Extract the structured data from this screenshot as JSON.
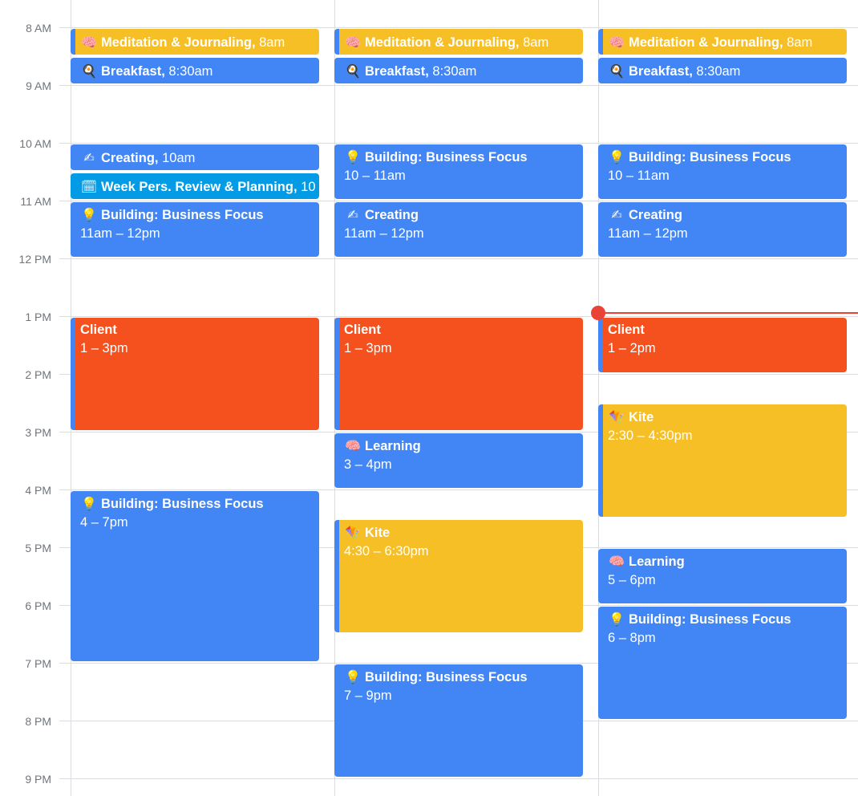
{
  "time_labels": [
    "8 AM",
    "9 AM",
    "10 AM",
    "11 AM",
    "12 PM",
    "1 PM",
    "2 PM",
    "3 PM",
    "4 PM",
    "5 PM",
    "6 PM",
    "7 PM",
    "8 PM",
    "9 PM"
  ],
  "colors": {
    "blue": "#4285f4",
    "yellow": "#f6bf26",
    "orange": "#f4511e",
    "cyan": "#039be5",
    "now_indicator": "#ea4335"
  },
  "days": [
    {
      "events": [
        {
          "title": "Meditation & Journaling,",
          "time": "8am",
          "icon": "brain-icon",
          "glyph": "🧠",
          "color": "yellow"
        },
        {
          "title": "Breakfast,",
          "time": "8:30am",
          "icon": "frying-pan-icon",
          "glyph": "🍳",
          "color": "blue"
        },
        {
          "title": "Creating,",
          "time": "10am",
          "icon": "writing-hand-icon",
          "glyph": "✍",
          "color": "blue"
        },
        {
          "title": "Week Pers. Review & Planning,",
          "time": "10",
          "icon": "calendar-icon",
          "glyph": "🗓",
          "color": "cyan"
        },
        {
          "title": "Building: Business Focus",
          "time": "11am – 12pm",
          "icon": "light-bulb-icon",
          "glyph": "💡",
          "color": "blue"
        },
        {
          "title": "Client",
          "time": "1 – 3pm",
          "icon": "",
          "glyph": "",
          "color": "orange"
        },
        {
          "title": "Building: Business Focus",
          "time": "4 – 7pm",
          "icon": "light-bulb-icon",
          "glyph": "💡",
          "color": "blue"
        }
      ]
    },
    {
      "events": [
        {
          "title": "Meditation & Journaling,",
          "time": "8am",
          "icon": "brain-icon",
          "glyph": "🧠",
          "color": "yellow"
        },
        {
          "title": "Breakfast,",
          "time": "8:30am",
          "icon": "frying-pan-icon",
          "glyph": "🍳",
          "color": "blue"
        },
        {
          "title": "Building: Business Focus",
          "time": "10 – 11am",
          "icon": "light-bulb-icon",
          "glyph": "💡",
          "color": "blue"
        },
        {
          "title": "Creating",
          "time": "11am – 12pm",
          "icon": "writing-hand-icon",
          "glyph": "✍",
          "color": "blue"
        },
        {
          "title": "Client",
          "time": "1 – 3pm",
          "icon": "",
          "glyph": "",
          "color": "orange"
        },
        {
          "title": "Learning",
          "time": "3 – 4pm",
          "icon": "brain-icon",
          "glyph": "🧠",
          "color": "blue"
        },
        {
          "title": "Kite",
          "time": "4:30 – 6:30pm",
          "icon": "kite-icon",
          "glyph": "🪁",
          "color": "yellow"
        },
        {
          "title": "Building: Business Focus",
          "time": "7 – 9pm",
          "icon": "light-bulb-icon",
          "glyph": "💡",
          "color": "blue"
        }
      ]
    },
    {
      "events": [
        {
          "title": "Meditation & Journaling,",
          "time": "8am",
          "icon": "brain-icon",
          "glyph": "🧠",
          "color": "yellow"
        },
        {
          "title": "Breakfast,",
          "time": "8:30am",
          "icon": "frying-pan-icon",
          "glyph": "🍳",
          "color": "blue"
        },
        {
          "title": "Building: Business Focus",
          "time": "10 – 11am",
          "icon": "light-bulb-icon",
          "glyph": "💡",
          "color": "blue"
        },
        {
          "title": "Creating",
          "time": "11am – 12pm",
          "icon": "writing-hand-icon",
          "glyph": "✍",
          "color": "blue"
        },
        {
          "title": "Client",
          "time": "1 – 2pm",
          "icon": "",
          "glyph": "",
          "color": "orange"
        },
        {
          "title": "Kite",
          "time": "2:30 – 4:30pm",
          "icon": "kite-icon",
          "glyph": "🪁",
          "color": "yellow"
        },
        {
          "title": "Learning",
          "time": "5 – 6pm",
          "icon": "brain-icon",
          "glyph": "🧠",
          "color": "blue"
        },
        {
          "title": "Building: Business Focus",
          "time": "6 – 8pm",
          "icon": "light-bulb-icon",
          "glyph": "💡",
          "color": "blue"
        }
      ]
    }
  ]
}
